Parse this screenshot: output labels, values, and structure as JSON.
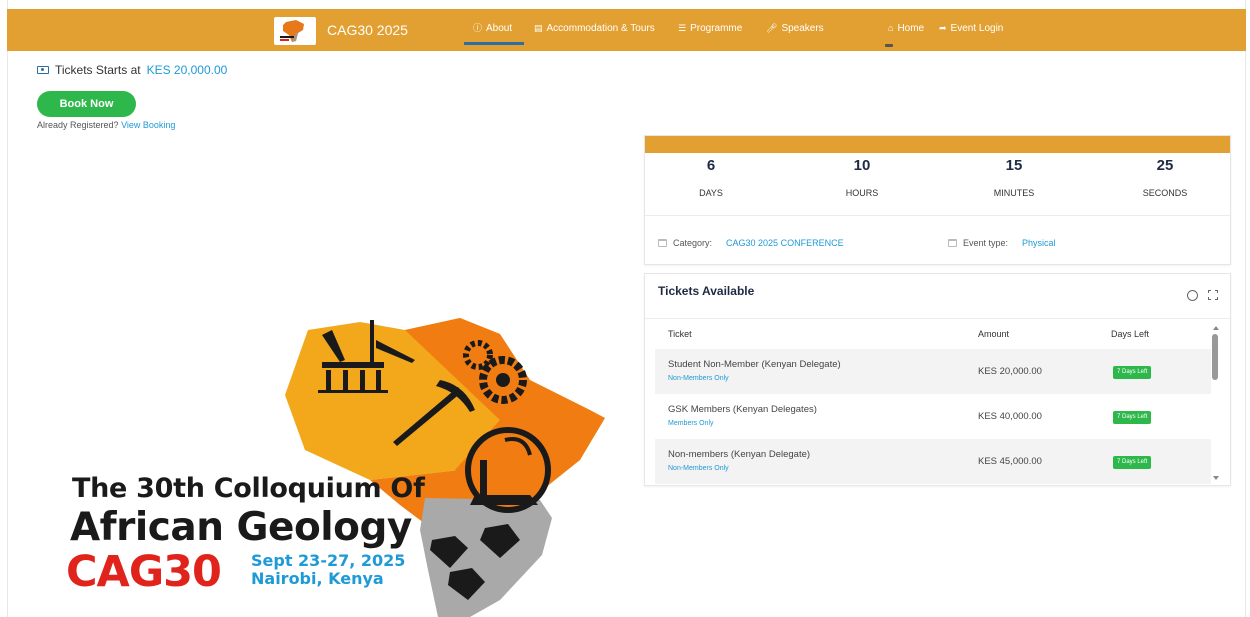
{
  "nav": {
    "brand": "CAG30 2025",
    "items": [
      {
        "label": "About",
        "icon": "info-circle-icon",
        "active": true
      },
      {
        "label": "Accommodation & Tours",
        "icon": "book-icon"
      },
      {
        "label": "Programme",
        "icon": "list-icon"
      },
      {
        "label": "Speakers",
        "icon": "microphone-icon"
      },
      {
        "label": "Home",
        "icon": "home-icon"
      },
      {
        "label": "Event Login",
        "icon": "share-arrow-icon"
      }
    ]
  },
  "tickets_start": {
    "label": "Tickets Starts at",
    "price": "KES 20,000.00"
  },
  "book_button": "Book Now",
  "already_registered": {
    "text": "Already Registered?",
    "link": "View Booking"
  },
  "poster": {
    "line1": "The 30th Colloquium Of",
    "line2": "African Geology",
    "acronym": "CAG30",
    "dates": "Sept 23-27, 2025",
    "location": "Nairobi, Kenya"
  },
  "countdown": [
    {
      "value": "6",
      "label": "DAYS"
    },
    {
      "value": "10",
      "label": "HOURS"
    },
    {
      "value": "15",
      "label": "MINUTES"
    },
    {
      "value": "25",
      "label": "SECONDS"
    }
  ],
  "event_meta": {
    "category_label": "Category:",
    "category_value": "CAG30 2025 CONFERENCE",
    "type_label": "Event type:",
    "type_value": "Physical"
  },
  "tickets": {
    "title": "Tickets Available",
    "headers": {
      "ticket": "Ticket",
      "amount": "Amount",
      "days": "Days Left"
    },
    "rows": [
      {
        "name": "Student Non-Member (Kenyan Delegate)",
        "sub": "Non-Members Only",
        "amount": "KES 20,000.00",
        "days": "7 Days Left"
      },
      {
        "name": "GSK Members (Kenyan Delegates)",
        "sub": "Members Only",
        "amount": "KES 40,000.00",
        "days": "7 Days Left"
      },
      {
        "name": "Non-members (Kenyan Delegate)",
        "sub": "Non-Members Only",
        "amount": "KES 45,000.00",
        "days": "7 Days Left"
      }
    ]
  },
  "colors": {
    "brand_orange": "#e3a032",
    "accent_blue": "#1e9ad6",
    "success_green": "#2eb84b",
    "poster_red": "#e0241b"
  }
}
